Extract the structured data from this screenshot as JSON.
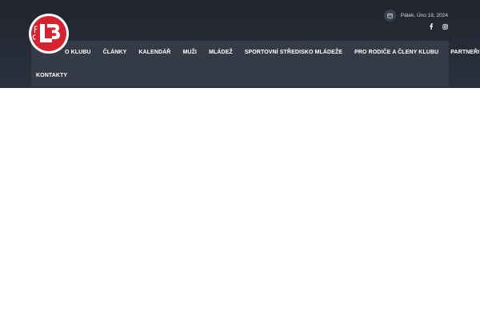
{
  "topbar": {
    "date": "Pátek, Úno 16, 2024",
    "date_icon": "calendar-icon",
    "social": [
      "facebook-icon",
      "instagram-icon"
    ]
  },
  "logo": {
    "text": "FC LB",
    "colors": {
      "red": "#d42331",
      "white": "#ffffff"
    }
  },
  "nav": {
    "items": [
      {
        "label": "O KLUBU"
      },
      {
        "label": "ČLÁNKY"
      },
      {
        "label": "KALENDÁŘ"
      },
      {
        "label": "MUŽI"
      },
      {
        "label": "MLÁDEŽ"
      },
      {
        "label": "SPORTOVNÍ STŘEDISKO MLÁDEŽE"
      },
      {
        "label": "PRO RODIČE A ČLENY KLUBU"
      },
      {
        "label": "PARTNEŘI"
      },
      {
        "label": "KONTAKTY"
      }
    ]
  },
  "colors": {
    "header_bg": "#262c37",
    "nav_bg": "#343b47",
    "accent": "#d42331"
  }
}
